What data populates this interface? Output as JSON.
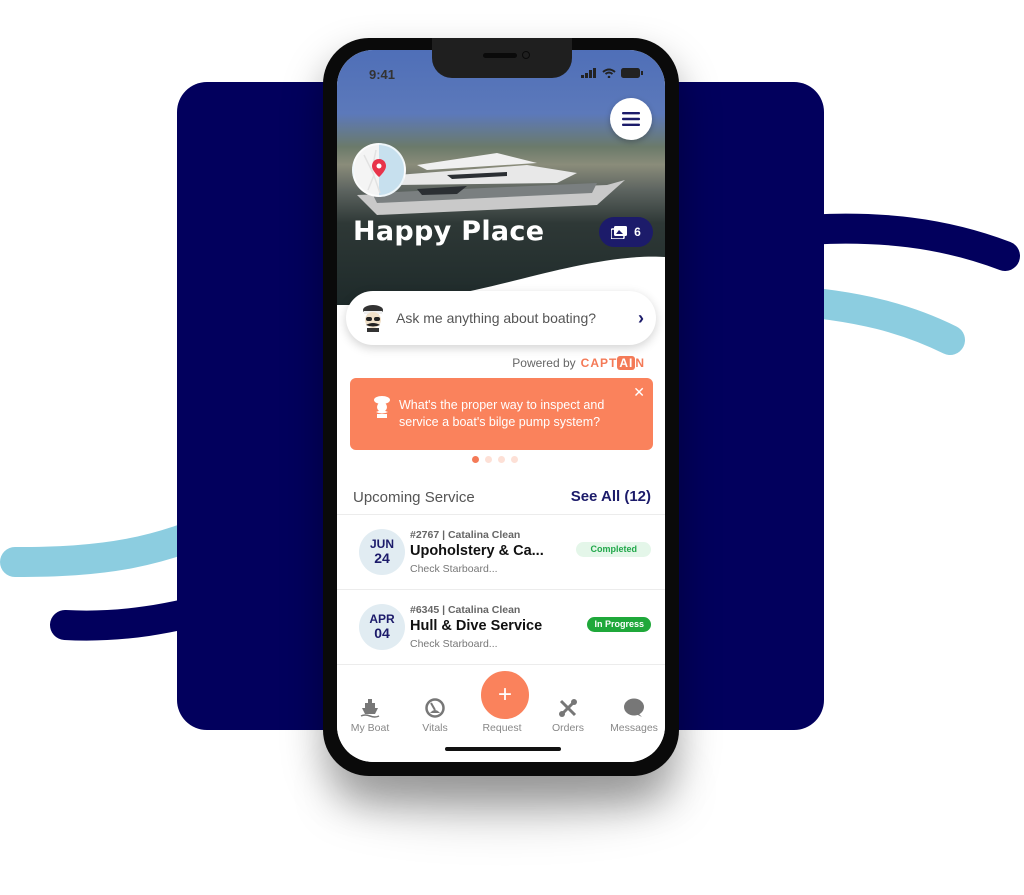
{
  "status_bar": {
    "time": "9:41",
    "icons": [
      "signal-icon",
      "wifi-icon",
      "battery-icon"
    ]
  },
  "hero": {
    "boat_name": "Happy Place",
    "photo_count": "6",
    "menu_icon": "hamburger-icon",
    "location_icon": "map-pin-icon"
  },
  "assistant": {
    "prompt_placeholder": "Ask me anything about boating?",
    "powered_by_label": "Powered by",
    "brand_prefix": "CAPT",
    "brand_ai": "AI",
    "brand_suffix": "N"
  },
  "tip_card": {
    "text": "What's the proper way to inspect and service a boat's bilge pump system?",
    "close_icon": "close-icon",
    "page_count": 4,
    "active_page": 1
  },
  "upcoming_service": {
    "title": "Upcoming Service",
    "see_all_label": "See All (12)",
    "items": [
      {
        "month": "JUN",
        "day": "24",
        "meta": "#2767 | Catalina Clean",
        "title": "Upoholstery & Ca...",
        "subtitle": "Check Starboard...",
        "status": "Completed"
      },
      {
        "month": "APR",
        "day": "04",
        "meta": "#6345 | Catalina Clean",
        "title": "Hull & Dive Service",
        "subtitle": "Check Starboard...",
        "status": "In Progress"
      }
    ]
  },
  "tab_bar": {
    "fab_label": "+",
    "tabs": [
      {
        "label": "My Boat",
        "icon": "boat-icon"
      },
      {
        "label": "Vitals",
        "icon": "gauge-icon"
      },
      {
        "label": "Request",
        "icon": "plus-icon"
      },
      {
        "label": "Orders",
        "icon": "tools-icon"
      },
      {
        "label": "Messages",
        "icon": "chat-bubble-icon"
      }
    ]
  },
  "colors": {
    "navy": "#02005d",
    "brand_navy": "#1c1b6a",
    "accent_orange": "#fa825c",
    "light_blue": "#8ccde0",
    "success_green": "#1fa83a"
  }
}
